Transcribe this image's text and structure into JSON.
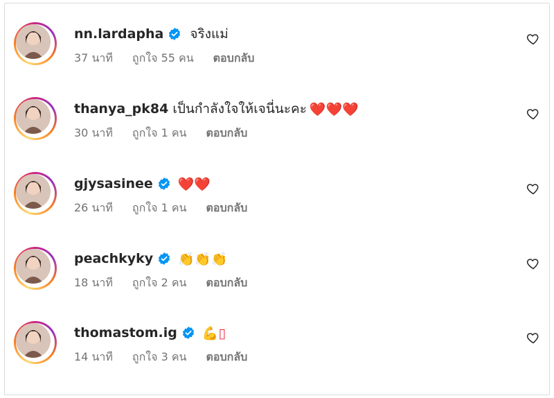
{
  "comments": [
    {
      "username": "nn.lardapha",
      "verified": true,
      "text": "จริงแม่",
      "emoji": "",
      "time": "37 นาที",
      "likes": "ถูกใจ 55 คน",
      "reply": "ตอบกลับ",
      "avatar": "woman-avatar"
    },
    {
      "username": "thanya_pk84",
      "verified": false,
      "text": "เป็นกำลังใจให้เจนี่นะคะ",
      "emoji": "❤️❤️❤️",
      "time": "30 นาที",
      "likes": "ถูกใจ 1 คน",
      "reply": "ตอบกลับ",
      "avatar": "woman-avatar"
    },
    {
      "username": "gjysasinee",
      "verified": true,
      "text": "",
      "emoji": "❤️❤️",
      "time": "26 นาที",
      "likes": "ถูกใจ 1 คน",
      "reply": "ตอบกลับ",
      "avatar": "woman-avatar"
    },
    {
      "username": "peachkyky",
      "verified": true,
      "text": "",
      "emoji": "👏👏👏",
      "time": "18 นาที",
      "likes": "ถูกใจ 2 คน",
      "reply": "ตอบกลับ",
      "avatar": "man-avatar"
    },
    {
      "username": "thomastom.ig",
      "verified": true,
      "text": "",
      "emoji": "💪▯",
      "time": "14 นาที",
      "likes": "ถูกใจ 3 คน",
      "reply": "ตอบกลับ",
      "avatar": "man-avatar"
    }
  ],
  "colors": {
    "verified": "#0095f6",
    "muted": "#737373",
    "text": "#262626"
  }
}
